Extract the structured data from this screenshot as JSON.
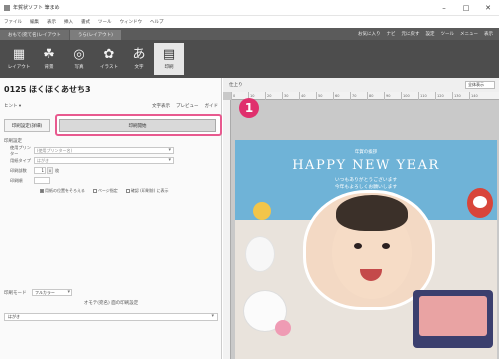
{
  "window": {
    "title": "年賀状ソフト 筆まめ",
    "controls": {
      "minimize": "–",
      "maximize": "□",
      "close": "✕"
    }
  },
  "menu": [
    "ファイル",
    "編集",
    "表示",
    "挿入",
    "書式",
    "ツール",
    "ウィンドウ",
    "ヘルプ"
  ],
  "tabs": [
    {
      "label": "おもて(宛て名)レイアウト",
      "active": false
    },
    {
      "label": "うら(レイアウト)",
      "active": true
    }
  ],
  "tabbar_right": [
    "お気に入り",
    "ナビ",
    "元に戻す",
    "設定",
    "ツール",
    "メニュー",
    "表示"
  ],
  "toolbar": [
    {
      "label": "レイアウト",
      "icon": "layout-icon",
      "glyph": "▦",
      "active": false
    },
    {
      "label": "背景",
      "icon": "background-icon",
      "glyph": "☘",
      "active": false
    },
    {
      "label": "写真",
      "icon": "photo-icon",
      "glyph": "◎",
      "active": false
    },
    {
      "label": "イラスト",
      "icon": "illustration-icon",
      "glyph": "✿",
      "active": false
    },
    {
      "label": "文字",
      "icon": "text-icon",
      "glyph": "あ",
      "active": false
    },
    {
      "label": "印刷",
      "icon": "print-icon",
      "glyph": "▤",
      "active": true
    }
  ],
  "left": {
    "doc_title": "0125 ほくほくあせち3",
    "sub_left": "ヒント ▾",
    "sub_right": [
      "文字表示",
      "プレビュー",
      "ガイド"
    ],
    "btn_left": "印刷設定(詳細)",
    "btn_main": "印刷開始",
    "badge": "1",
    "section": "印刷設定",
    "rows": [
      {
        "label": "使用プリンター",
        "value": "(使用プリンター名)"
      },
      {
        "label": "用紙タイプ",
        "value": "はがき"
      }
    ],
    "copies_label": "印刷部数",
    "copies_value": "1",
    "copies_unit": "枚",
    "order_label": "印刷順",
    "order_value": "",
    "checks": [
      {
        "label": "用紙の位置をそろえる",
        "checked": true
      },
      {
        "label": "ページ指定",
        "checked": false
      },
      {
        "label": "確認 (印刷前) に表示",
        "checked": false
      }
    ],
    "mode_label": "印刷モード",
    "mode_value": "フルカラー",
    "center_caption": "オモテ(宛名) 面の印刷設定",
    "wide_value": "はがき"
  },
  "right": {
    "canvas_label": "仕上り",
    "zoom": "全体表示",
    "ruler": [
      "0",
      "10",
      "20",
      "30",
      "40",
      "50",
      "60",
      "70",
      "80",
      "90",
      "100",
      "110",
      "120",
      "130",
      "140"
    ]
  },
  "card": {
    "small": "年賀の挨拶",
    "title": "HAPPY NEW YEAR",
    "msg1": "いつもありがとうございます",
    "msg2": "今年もよろしくお願いします"
  },
  "colors": {
    "accent_pink": "#e0306d",
    "sky": "#6fb3d7",
    "toolbar": "#4d4d4d"
  }
}
